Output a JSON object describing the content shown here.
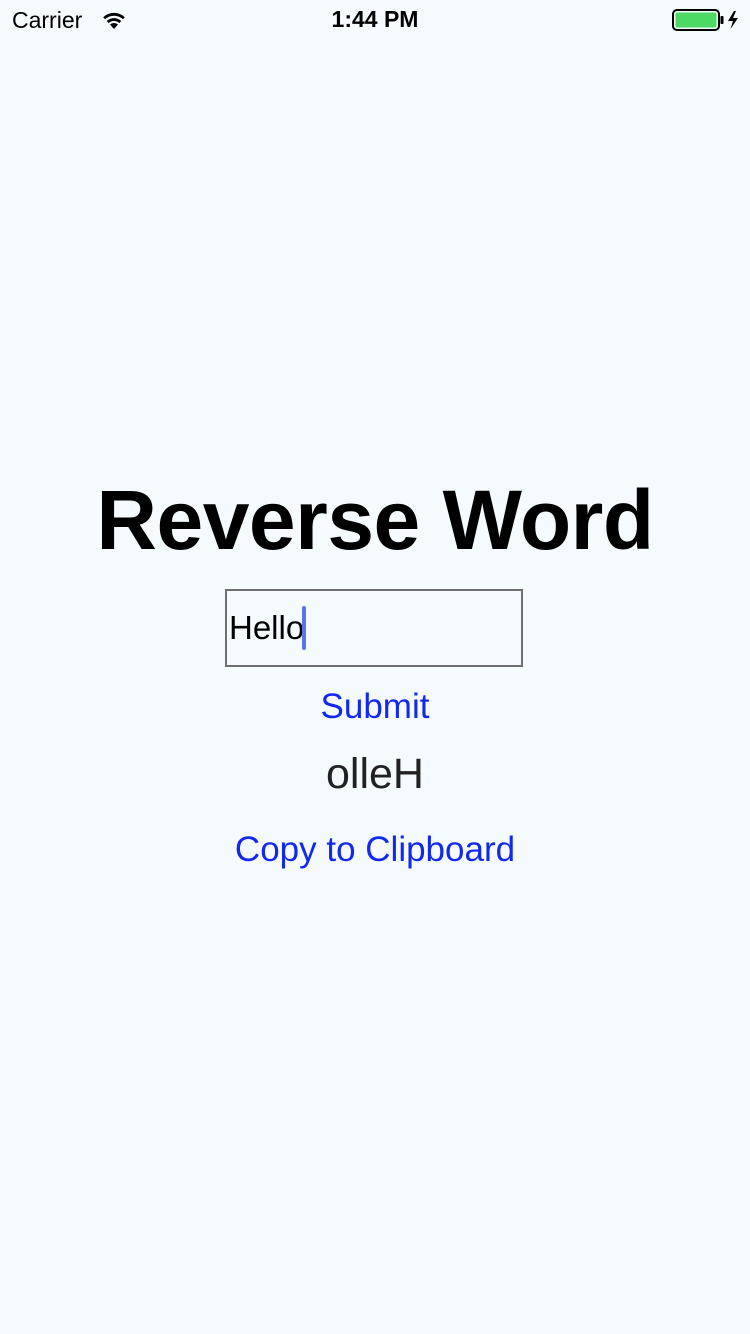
{
  "status_bar": {
    "carrier": "Carrier",
    "time": "1:44 PM",
    "wifi_icon": "wifi-icon",
    "battery_icon": "battery-charging-icon",
    "battery_level": 1.0,
    "battery_color": "#4CD964"
  },
  "app": {
    "title": "Reverse Word",
    "input": {
      "value": "Hello",
      "placeholder": ""
    },
    "submit_label": "Submit",
    "result": "olleH",
    "copy_label": "Copy to Clipboard"
  },
  "colors": {
    "background": "#F5FBFD",
    "link": "#1228F0",
    "caret": "#5C74E4"
  }
}
